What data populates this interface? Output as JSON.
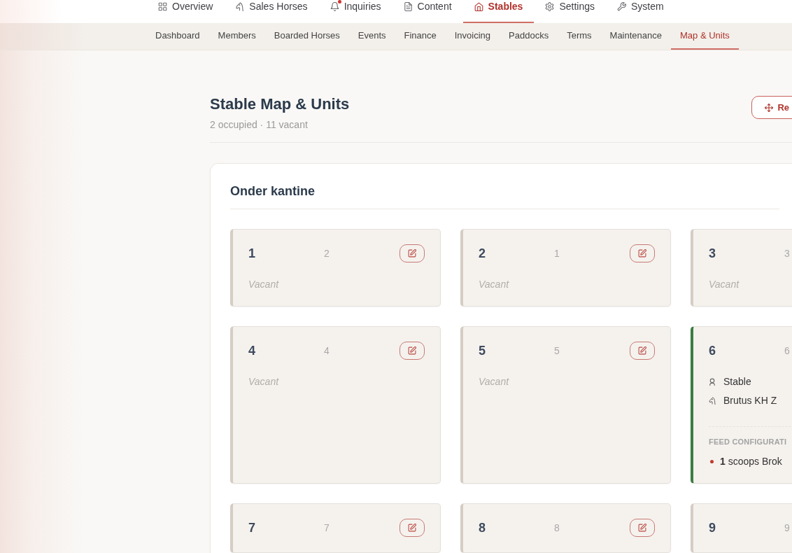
{
  "top_nav": [
    {
      "label": "Overview",
      "selected": false,
      "notification": false
    },
    {
      "label": "Sales Horses",
      "selected": false,
      "notification": false
    },
    {
      "label": "Inquiries",
      "selected": false,
      "notification": true
    },
    {
      "label": "Content",
      "selected": false,
      "notification": false
    },
    {
      "label": "Stables",
      "selected": true,
      "notification": false
    },
    {
      "label": "Settings",
      "selected": false,
      "notification": false
    },
    {
      "label": "System",
      "selected": false,
      "notification": false
    }
  ],
  "sub_nav": [
    {
      "label": "Dashboard",
      "selected": false
    },
    {
      "label": "Members",
      "selected": false
    },
    {
      "label": "Boarded Horses",
      "selected": false
    },
    {
      "label": "Events",
      "selected": false
    },
    {
      "label": "Finance",
      "selected": false
    },
    {
      "label": "Invoicing",
      "selected": false
    },
    {
      "label": "Paddocks",
      "selected": false
    },
    {
      "label": "Terms",
      "selected": false
    },
    {
      "label": "Maintenance",
      "selected": false
    },
    {
      "label": "Map & Units",
      "selected": true
    }
  ],
  "page": {
    "title": "Stable Map & Units",
    "subtitle": "2 occupied · 11 vacant",
    "action_button": "Re"
  },
  "sections": [
    {
      "title": "Onder kantine",
      "units": [
        {
          "number": "1",
          "capacity": "2",
          "occupied": false,
          "status": "Vacant",
          "edit_button": true
        },
        {
          "number": "2",
          "capacity": "1",
          "occupied": false,
          "status": "Vacant",
          "edit_button": true
        },
        {
          "number": "3",
          "capacity": "3",
          "occupied": false,
          "status": "Vacant"
        },
        {
          "number": "4",
          "capacity": "4",
          "occupied": false,
          "status": "Vacant",
          "edit_button": true
        },
        {
          "number": "5",
          "capacity": "5",
          "occupied": false,
          "status": "Vacant",
          "edit_button": true
        },
        {
          "number": "6",
          "capacity": "6",
          "occupied": true,
          "member": "Stable",
          "horse": "Brutus KH Z",
          "feed_label": "FEED CONFIGURATI",
          "feed_items": [
            "**1** scoops Brok"
          ]
        },
        {
          "number": "7",
          "capacity": "7",
          "occupied": false,
          "edit_button": true
        },
        {
          "number": "8",
          "capacity": "8",
          "occupied": false,
          "edit_button": true
        },
        {
          "number": "9",
          "capacity": "9",
          "occupied": false
        }
      ]
    }
  ]
}
